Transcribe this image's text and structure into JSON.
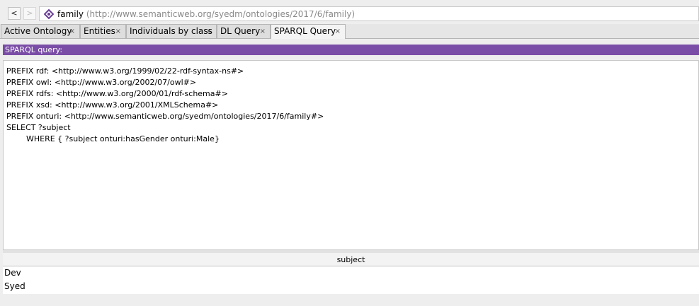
{
  "address_bar": {
    "back_label": "<",
    "forward_label": ">",
    "ontology_icon": "ontology-diamond-icon",
    "ontology_name": "family",
    "ontology_iri": "(http://www.semanticweb.org/syedm/ontologies/2017/6/family)"
  },
  "tabs": [
    {
      "label": "Active Ontology",
      "close": "×",
      "active": false
    },
    {
      "label": "Entities",
      "close": "×",
      "active": false
    },
    {
      "label": "Individuals by class",
      "close": "×",
      "active": false
    },
    {
      "label": "DL Query",
      "close": "×",
      "active": false
    },
    {
      "label": "SPARQL Query",
      "close": "×",
      "active": true
    }
  ],
  "sparql": {
    "header": "SPARQL query:",
    "query_lines": [
      "PREFIX rdf: <http://www.w3.org/1999/02/22-rdf-syntax-ns#>",
      "PREFIX owl: <http://www.w3.org/2002/07/owl#>",
      "PREFIX rdfs: <http://www.w3.org/2000/01/rdf-schema#>",
      "PREFIX xsd: <http://www.w3.org/2001/XMLSchema#>",
      "PREFIX onturi: <http://www.semanticweb.org/syedm/ontologies/2017/6/family#>",
      "SELECT ?subject",
      "\t\tWHERE { ?subject onturi:hasGender onturi:Male}"
    ]
  },
  "results": {
    "column_header": "subject",
    "rows": [
      "Dev",
      "Syed"
    ]
  },
  "colors": {
    "header_purple": "#7a4da6",
    "ontology_icon": "#6a3f96"
  }
}
